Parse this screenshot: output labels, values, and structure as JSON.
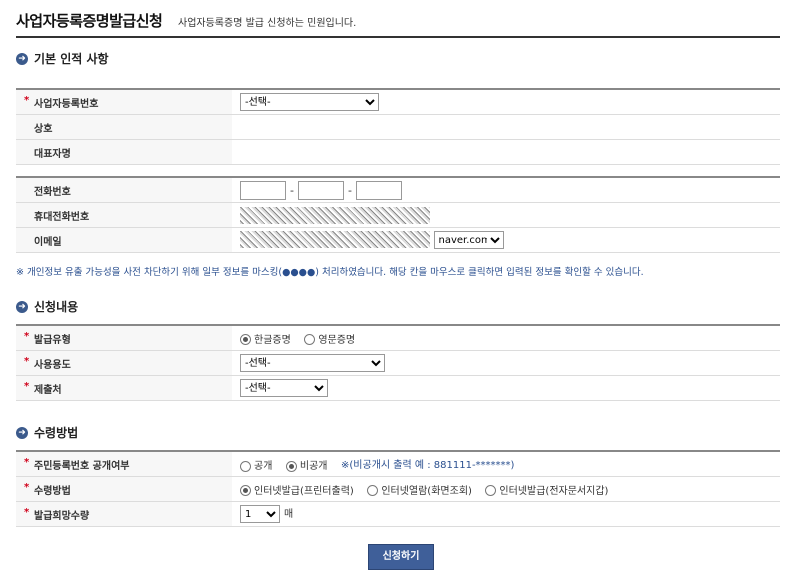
{
  "header": {
    "title": "사업자등록증명발급신청",
    "subtitle": "사업자등록증명 발급 신청하는 민원입니다."
  },
  "basic": {
    "heading": "기본 인적 사항",
    "bizno_label": "사업자등록번호",
    "bizno_value": "-선택-",
    "company_label": "상호",
    "ceo_label": "대표자명",
    "phone_label": "전화번호",
    "phone_sep": "-",
    "mobile_label": "휴대전화번호",
    "email_label": "이메일",
    "email_domain": "naver.com"
  },
  "notice": "※ 개인정보 유출 가능성을 사전 차단하기 위해 일부 정보를 마스킹(●●●●) 처리하였습니다. 해당 칸을 마우스로 클릭하면 입력된 정보를 확인할 수 있습니다.",
  "request": {
    "heading": "신청내용",
    "type_label": "발급유형",
    "type_options": [
      "한글증명",
      "영문증명"
    ],
    "purpose_label": "사용용도",
    "purpose_value": "-선택-",
    "submit_to_label": "제출처",
    "submit_to_value": "-선택-"
  },
  "receive": {
    "heading": "수령방법",
    "disclose_label": "주민등록번호 공개여부",
    "disclose_options": [
      "공개",
      "비공개"
    ],
    "disclose_note": "※(비공개시 출력 예 : 881111-*******)",
    "method_label": "수령방법",
    "method_options": [
      "인터넷발급(프린터출력)",
      "인터넷열람(화면조회)",
      "인터넷발급(전자문서지갑)"
    ],
    "qty_label": "발급희망수량",
    "qty_value": "1",
    "qty_unit": "매"
  },
  "actions": {
    "submit": "신청하기"
  },
  "required_mark": "*"
}
